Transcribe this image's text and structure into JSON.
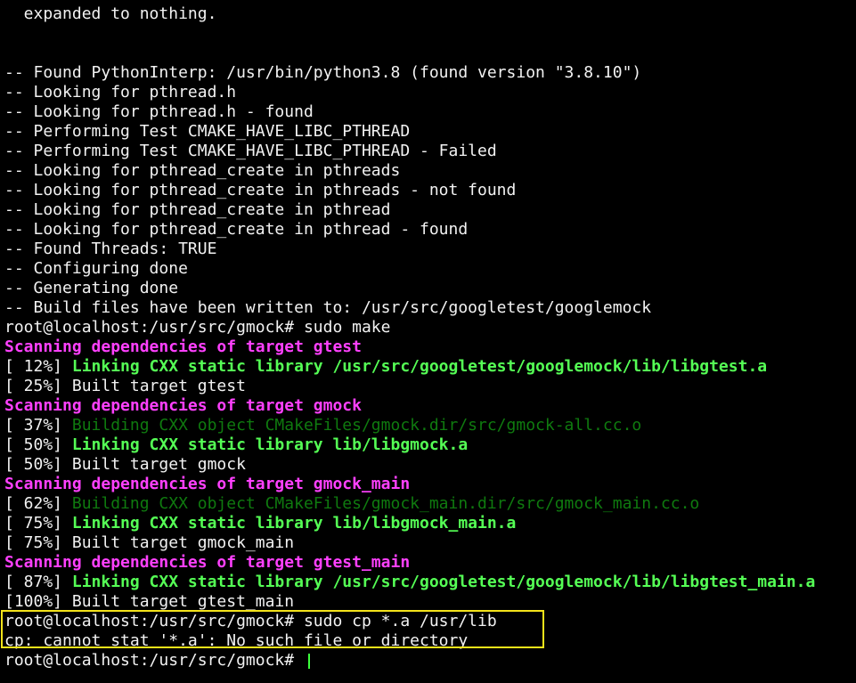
{
  "terminal": {
    "colors": {
      "background": "#000000",
      "text": "#f2f2f2",
      "scanning": "#ff40ff",
      "linking": "#55ff55",
      "building": "#0f7a0f",
      "highlight_border": "#f4e31a",
      "cursor": "#3cff3c"
    },
    "lines": [
      "  expanded to nothing.",
      "",
      "",
      "-- Found PythonInterp: /usr/bin/python3.8 (found version \"3.8.10\")",
      "-- Looking for pthread.h",
      "-- Looking for pthread.h - found",
      "-- Performing Test CMAKE_HAVE_LIBC_PTHREAD",
      "-- Performing Test CMAKE_HAVE_LIBC_PTHREAD - Failed",
      "-- Looking for pthread_create in pthreads",
      "-- Looking for pthread_create in pthreads - not found",
      "-- Looking for pthread_create in pthread",
      "-- Looking for pthread_create in pthread - found",
      "-- Found Threads: TRUE",
      "-- Configuring done",
      "-- Generating done",
      "-- Build files have been written to: /usr/src/googletest/googlemock",
      "root@localhost:/usr/src/gmock# sudo make",
      "Scanning dependencies of target gtest",
      "Linking CXX static library /usr/src/googletest/googlemock/lib/libgtest.a",
      "[ 25%] Built target gtest",
      "Scanning dependencies of target gmock",
      "Building CXX object CMakeFiles/gmock.dir/src/gmock-all.cc.o",
      "Linking CXX static library lib/libgmock.a",
      "[ 50%] Built target gmock",
      "Scanning dependencies of target gmock_main",
      "Building CXX object CMakeFiles/gmock_main.dir/src/gmock_main.cc.o",
      "Linking CXX static library lib/libgmock_main.a",
      "[ 75%] Built target gmock_main",
      "Scanning dependencies of target gtest_main",
      "Linking CXX static library /usr/src/googletest/googlemock/lib/libgtest_main.a",
      "[100%] Built target gtest_main",
      "root@localhost:/usr/src/gmock# sudo cp *.a /usr/lib",
      "cp: cannot stat '*.a': No such file or directory",
      "root@localhost:/usr/src/gmock# "
    ],
    "progress_prefixes": {
      "p12": "[ 12%] ",
      "p37": "[ 37%] ",
      "p50": "[ 50%] ",
      "p62": "[ 62%] ",
      "p75": "[ 75%] ",
      "p87": "[ 87%] "
    }
  }
}
